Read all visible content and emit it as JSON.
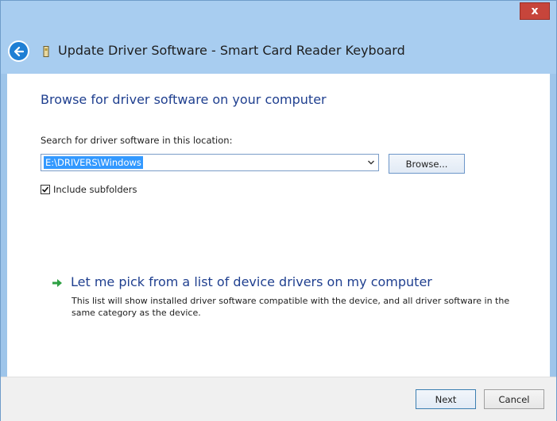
{
  "window": {
    "title": "Update Driver Software - Smart Card Reader Keyboard",
    "close_label": "x"
  },
  "content": {
    "heading": "Browse for driver software on your computer",
    "search_label": "Search for driver software in this location:",
    "path_value": "E:\\DRIVERS\\Windows",
    "browse_label": "Browse...",
    "include_subfolders_label": "Include subfolders",
    "include_subfolders_checked": true,
    "pick_title": "Let me pick from a list of device drivers on my computer",
    "pick_description": "This list will show installed driver software compatible with the device, and all driver software in the same category as the device."
  },
  "footer": {
    "next_label": "Next",
    "cancel_label": "Cancel"
  },
  "icons": {
    "back": "back-arrow-icon",
    "device": "smart-card-device-icon",
    "dropdown": "chevron-down-icon",
    "checkbox": "checkmark-icon",
    "link": "green-arrow-icon"
  },
  "colors": {
    "accent_blue": "#1f3f8f",
    "selection": "#3399ff",
    "close_red": "#c7453b",
    "link_arrow": "#2ea043",
    "titlebar": "#a8cdf0"
  }
}
